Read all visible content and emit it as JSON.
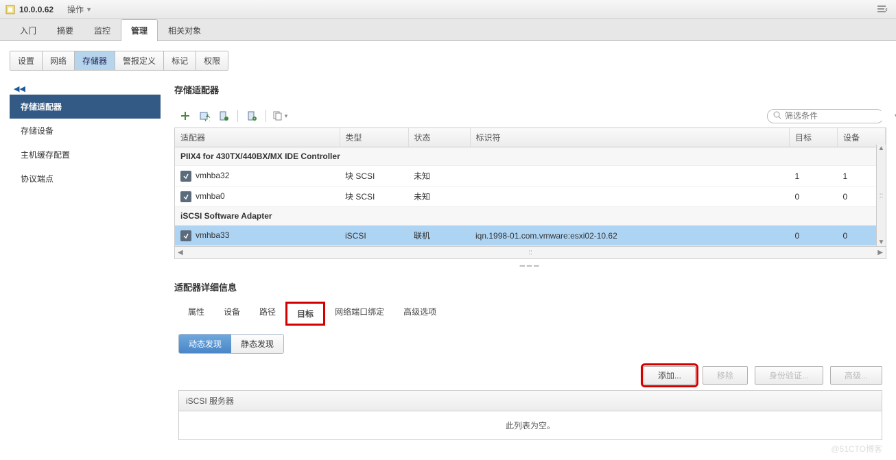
{
  "topbar": {
    "ip": "10.0.0.62",
    "actions": "操作"
  },
  "main_tabs": {
    "items": [
      "入门",
      "摘要",
      "监控",
      "管理",
      "相关对象"
    ],
    "active": 3
  },
  "sub_tabs": {
    "items": [
      "设置",
      "网络",
      "存储器",
      "警报定义",
      "标记",
      "权限"
    ],
    "active": 2
  },
  "sidebar": {
    "collapse": "◀◀",
    "items": [
      "存储适配器",
      "存储设备",
      "主机缓存配置",
      "协议端点"
    ],
    "active": 0
  },
  "adapters": {
    "title": "存储适配器",
    "filter_placeholder": "筛选条件",
    "columns": {
      "adapter": "适配器",
      "type": "类型",
      "status": "状态",
      "identifier": "标识符",
      "targets": "目标",
      "devices": "设备"
    },
    "group1": "PIIX4 for 430TX/440BX/MX IDE Controller",
    "rows1": [
      {
        "name": "vmhba32",
        "type": "块 SCSI",
        "status": "未知",
        "ident": "",
        "targets": "1",
        "devices": "1"
      },
      {
        "name": "vmhba0",
        "type": "块 SCSI",
        "status": "未知",
        "ident": "",
        "targets": "0",
        "devices": "0"
      }
    ],
    "group2": "iSCSI Software Adapter",
    "rows2": [
      {
        "name": "vmhba33",
        "type": "iSCSI",
        "status": "联机",
        "ident": "iqn.1998-01.com.vmware:esxi02-10.62",
        "targets": "0",
        "devices": "0"
      }
    ]
  },
  "details": {
    "title": "适配器详细信息",
    "tabs": [
      "属性",
      "设备",
      "路径",
      "目标",
      "网络端口绑定",
      "高级选项"
    ],
    "highlighted": 3,
    "pills": [
      "动态发现",
      "静态发现"
    ],
    "pill_active": 0,
    "buttons": {
      "add": "添加...",
      "remove": "移除",
      "auth": "身份验证...",
      "advanced": "高级..."
    },
    "server_col": "iSCSI 服务器",
    "empty": "此列表为空。"
  },
  "watermark": "@51CTO博客"
}
